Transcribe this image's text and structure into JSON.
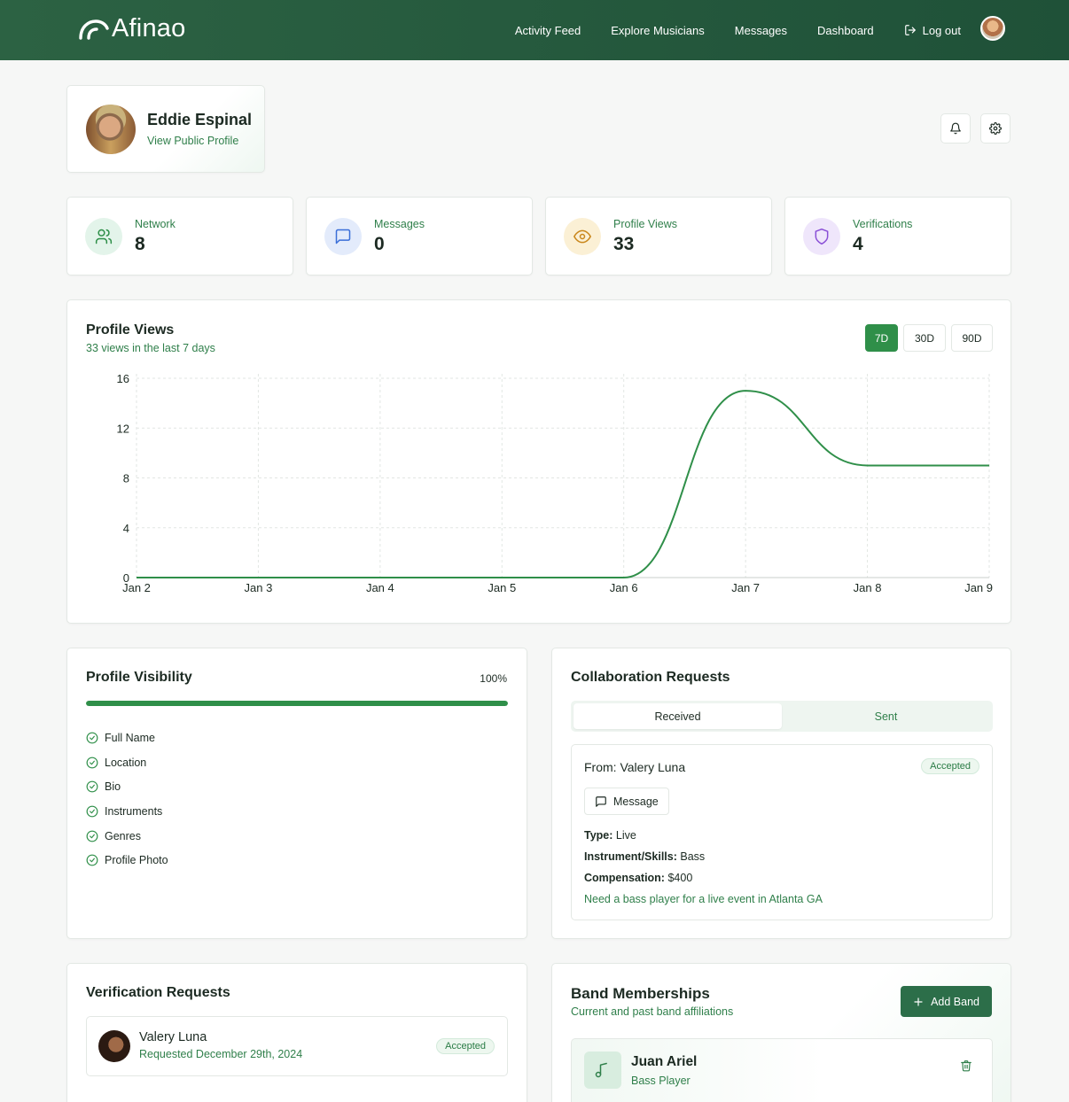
{
  "header": {
    "brand": "Afinao",
    "nav": [
      "Activity Feed",
      "Explore Musicians",
      "Messages",
      "Dashboard"
    ],
    "logout": "Log out"
  },
  "profile": {
    "name": "Eddie Espinal",
    "link": "View Public Profile"
  },
  "stats": [
    {
      "label": "Network",
      "value": "8",
      "icon": "users-icon",
      "bg": "#e3f4ea",
      "fg": "#2f8f49"
    },
    {
      "label": "Messages",
      "value": "0",
      "icon": "message-icon",
      "bg": "#e3ebfb",
      "fg": "#3a6ed8"
    },
    {
      "label": "Profile Views",
      "value": "33",
      "icon": "eye-icon",
      "bg": "#fbf0d5",
      "fg": "#c9861a"
    },
    {
      "label": "Verifications",
      "value": "4",
      "icon": "shield-icon",
      "bg": "#efe6fb",
      "fg": "#8a4fd6"
    }
  ],
  "views": {
    "title": "Profile Views",
    "subtitle": "33 views in the last 7 days",
    "ranges": [
      "7D",
      "30D",
      "90D"
    ],
    "active_range": "7D"
  },
  "chart_data": {
    "type": "line",
    "categories": [
      "Jan 2",
      "Jan 3",
      "Jan 4",
      "Jan 5",
      "Jan 6",
      "Jan 7",
      "Jan 8",
      "Jan 9"
    ],
    "series": [
      {
        "values": [
          0,
          0,
          0,
          0,
          0,
          15,
          9,
          9
        ]
      }
    ],
    "y_ticks": [
      0,
      4,
      8,
      12,
      16
    ],
    "ylim": [
      0,
      16
    ],
    "grid": true,
    "color": "#2f8f49"
  },
  "visibility": {
    "title": "Profile Visibility",
    "percent_label": "100%",
    "percent": 100,
    "items": [
      "Full Name",
      "Location",
      "Bio",
      "Instruments",
      "Genres",
      "Profile Photo"
    ]
  },
  "collab": {
    "title": "Collaboration Requests",
    "tabs": [
      "Received",
      "Sent"
    ],
    "request": {
      "from": "From: Valery Luna",
      "status": "Accepted",
      "message_btn": "Message",
      "type_label": "Type:",
      "type": "Live",
      "skills_label": "Instrument/Skills:",
      "skills": "Bass",
      "comp_label": "Compensation:",
      "comp": "$400",
      "note": "Need a bass player for a live event in Atlanta GA"
    }
  },
  "verification": {
    "title": "Verification Requests",
    "name": "Valery Luna",
    "date": "Requested December 29th, 2024",
    "status": "Accepted"
  },
  "band": {
    "title": "Band Memberships",
    "subtitle": "Current and past band affiliations",
    "add_label": "Add Band",
    "member_name": "Juan Ariel",
    "member_role": "Bass Player"
  }
}
